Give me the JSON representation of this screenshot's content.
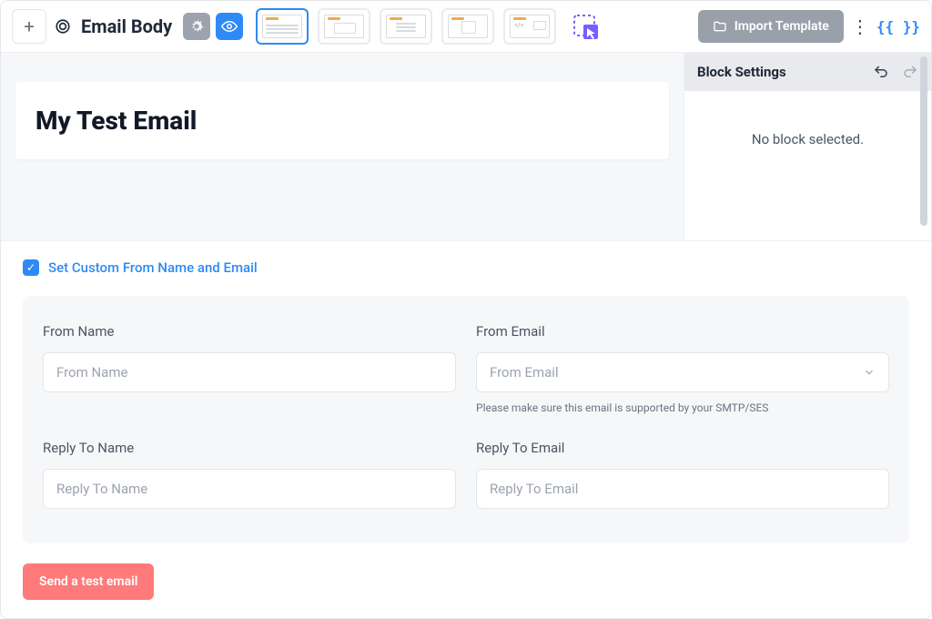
{
  "toolbar": {
    "title": "Email Body",
    "import_label": "Import Template",
    "braces_label": "{{ }}"
  },
  "editor": {
    "canvas_heading": "My Test Email",
    "panel_title": "Block Settings",
    "panel_empty": "No block selected."
  },
  "form": {
    "checkbox_label": "Set Custom From Name and Email",
    "from_name_label": "From Name",
    "from_name_placeholder": "From Name",
    "from_email_label": "From Email",
    "from_email_placeholder": "From Email",
    "from_email_helper": "Please make sure this email is supported by your SMTP/SES",
    "reply_name_label": "Reply To Name",
    "reply_name_placeholder": "Reply To Name",
    "reply_email_label": "Reply To Email",
    "reply_email_placeholder": "Reply To Email",
    "send_button": "Send a test email"
  }
}
